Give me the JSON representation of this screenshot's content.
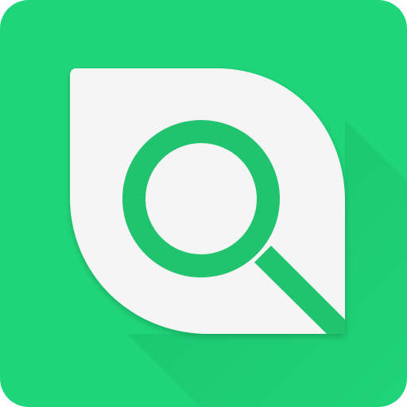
{
  "icon": {
    "name": "leaf-search-app-icon",
    "background_color": "#1fd57a",
    "shadow_color": "#19b868",
    "leaf_color": "#f5f5f5",
    "magnifier_color": "#22c36f",
    "glyph": "magnifying-glass-icon"
  }
}
